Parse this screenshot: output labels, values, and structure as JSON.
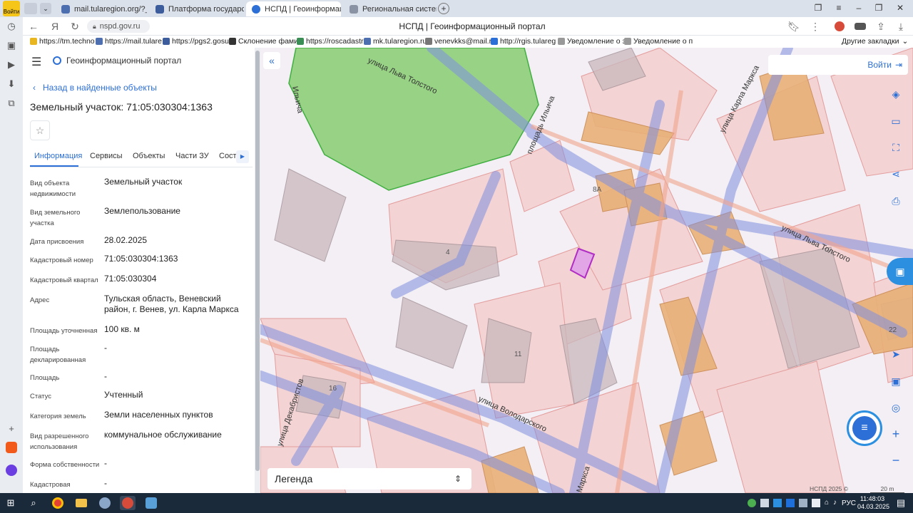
{
  "browser": {
    "tabs": [
      {
        "title": "mail.tularegion.org/?_task"
      },
      {
        "title": "Платформа государственн"
      },
      {
        "title": "НСПД | Геоинформаци"
      },
      {
        "title": "Региональная система за"
      }
    ],
    "active_tab": 2,
    "url": "nspd.gov.ru",
    "page_title": "НСПД | Геоинформационный портал",
    "bookmarks": [
      "https://tm.techno",
      "https://mail.tulare",
      "https://pgs2.gosu",
      "Склонение фами",
      "https://roscadastr",
      "mk.tularegion.ru",
      "venevkks@mail.ru",
      "http://rgis.tulareg",
      "Уведомление о з",
      "Уведомление о п"
    ],
    "other_bookmarks": "Другие закладки",
    "login_badge": "Войти"
  },
  "portal": {
    "title": "Геоинформационный портал",
    "back_link": "Назад в найденные объекты",
    "object_title": "Земельный участок: 71:05:030304:1363",
    "tabs": [
      "Информация",
      "Сервисы",
      "Объекты",
      "Части ЗУ",
      "Соста"
    ],
    "active_tab": 0,
    "fields": [
      {
        "label": "Вид объекта недвижимости",
        "value": "Земельный участок"
      },
      {
        "label": "Вид земельного участка",
        "value": "Землепользование"
      },
      {
        "label": "Дата присвоения",
        "value": "28.02.2025"
      },
      {
        "label": "Кадастровый номер",
        "value": "71:05:030304:1363"
      },
      {
        "label": "Кадастровый квартал",
        "value": "71:05:030304"
      },
      {
        "label": "Адрес",
        "value": "Тульская область, Веневский район, г. Венев, ул. Карла Маркса"
      },
      {
        "label": "Площадь уточненная",
        "value": "100 кв. м"
      },
      {
        "label": "Площадь декларированная",
        "value": "-"
      },
      {
        "label": "Площадь",
        "value": "-"
      },
      {
        "label": "Статус",
        "value": "Учтенный"
      },
      {
        "label": "Категория земель",
        "value": "Земли населенных пунктов"
      },
      {
        "label": "Вид разрешенного использования",
        "value": "коммунальное обслуживание"
      },
      {
        "label": "Форма собственности",
        "value": "-"
      },
      {
        "label": "Кадастровая",
        "value": "-"
      }
    ]
  },
  "map": {
    "login_button": "Войти",
    "legend_label": "Легенда",
    "copyright": "НСПД 2025 ©",
    "scale": "20 m",
    "street_labels": [
      "улица Льва Толстого",
      "улица Льва Толстого",
      "площадь Ильича",
      "Ильича",
      "улица Карла Маркса",
      "улица Декабристов",
      "улица Володарского",
      "Маркса"
    ],
    "house_numbers": [
      "8А",
      "4",
      "11",
      "16",
      "22"
    ],
    "colors": {
      "brand": "#2c6fd6",
      "parcel_selected": "#b02ec4",
      "park": "#8fd07a",
      "road": "#7f8fe0",
      "building": "#e8b078"
    }
  },
  "taskbar": {
    "lang": "РУС",
    "time": "11:48:03",
    "date": "04.03.2025"
  }
}
